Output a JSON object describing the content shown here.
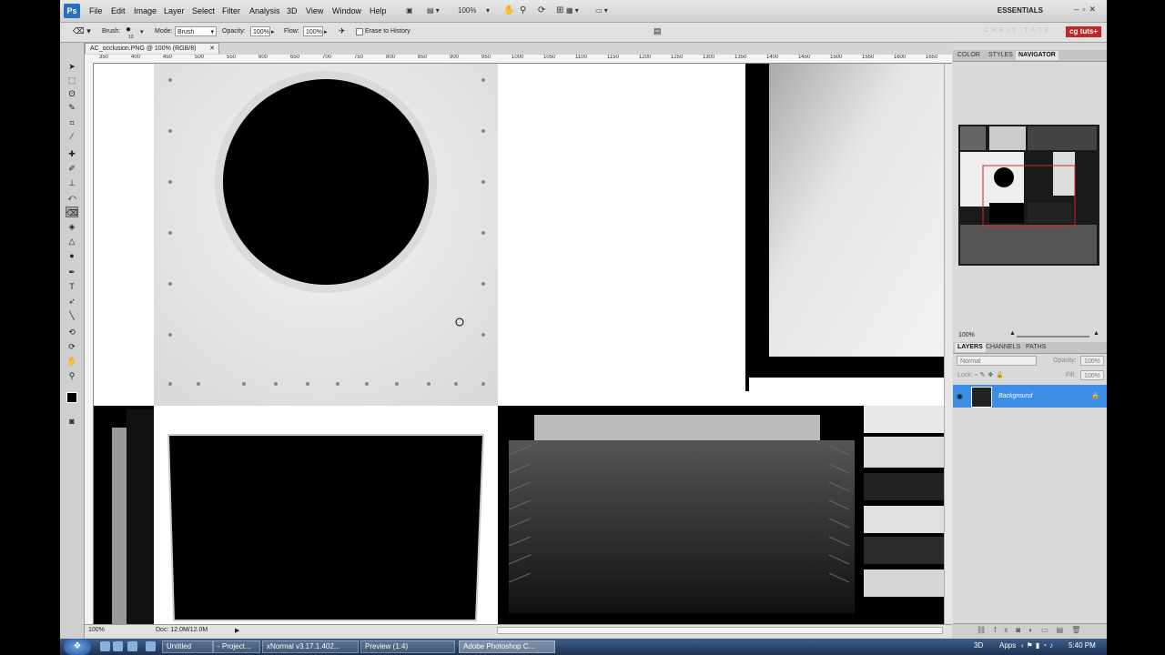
{
  "app": {
    "logo": "Ps",
    "menu": [
      "File",
      "Edit",
      "Image",
      "Layer",
      "Select",
      "Filter",
      "Analysis",
      "3D",
      "View",
      "Window",
      "Help"
    ],
    "zoom_display": "100%",
    "workspace": "ESSENTIALS",
    "watermark_name": "CHRIS TATE",
    "watermark_brand": "cg tuts+"
  },
  "options": {
    "brush_label": "Brush:",
    "brush_size": "13",
    "mode_label": "Mode:",
    "mode_value": "Brush",
    "opacity_label": "Opacity:",
    "opacity_value": "100%",
    "flow_label": "Flow:",
    "flow_value": "100%",
    "erase_history_label": "Erase to History"
  },
  "document": {
    "tab_title": "AC_occlusion.PNG @ 100% (RGB/8)",
    "ruler_labels": [
      "350",
      "400",
      "450",
      "500",
      "550",
      "600",
      "650",
      "700",
      "750",
      "800",
      "850",
      "900",
      "950",
      "1000",
      "1050",
      "1100",
      "1150",
      "1200",
      "1250",
      "1300",
      "1350",
      "1400",
      "1450",
      "1500",
      "1550",
      "1600",
      "1650"
    ],
    "status_zoom": "100%",
    "status_doc": "Doc: 12.0M/12.0M"
  },
  "panels": {
    "top_tabs": [
      "COLOR",
      "STYLES",
      "NAVIGATOR"
    ],
    "active_top_tab": "NAVIGATOR",
    "nav_zoom": "100%",
    "layer_tabs": [
      "LAYERS",
      "CHANNELS",
      "PATHS"
    ],
    "blend_mode": "Normal",
    "opacity_label": "Opacity:",
    "opacity_value": "100%",
    "lock_label": "Lock:",
    "fill_label": "Fill:",
    "fill_value": "100%",
    "layer_name": "Background"
  },
  "taskbar": {
    "items": [
      "Untitled",
      "- Project...",
      "xNormal v3.17.1.402...",
      "Preview (1:4)",
      "Adobe Photoshop C..."
    ],
    "active_index": 4,
    "tray_3d": "3D",
    "tray_apps": "Apps",
    "clock": "5:40 PM"
  }
}
